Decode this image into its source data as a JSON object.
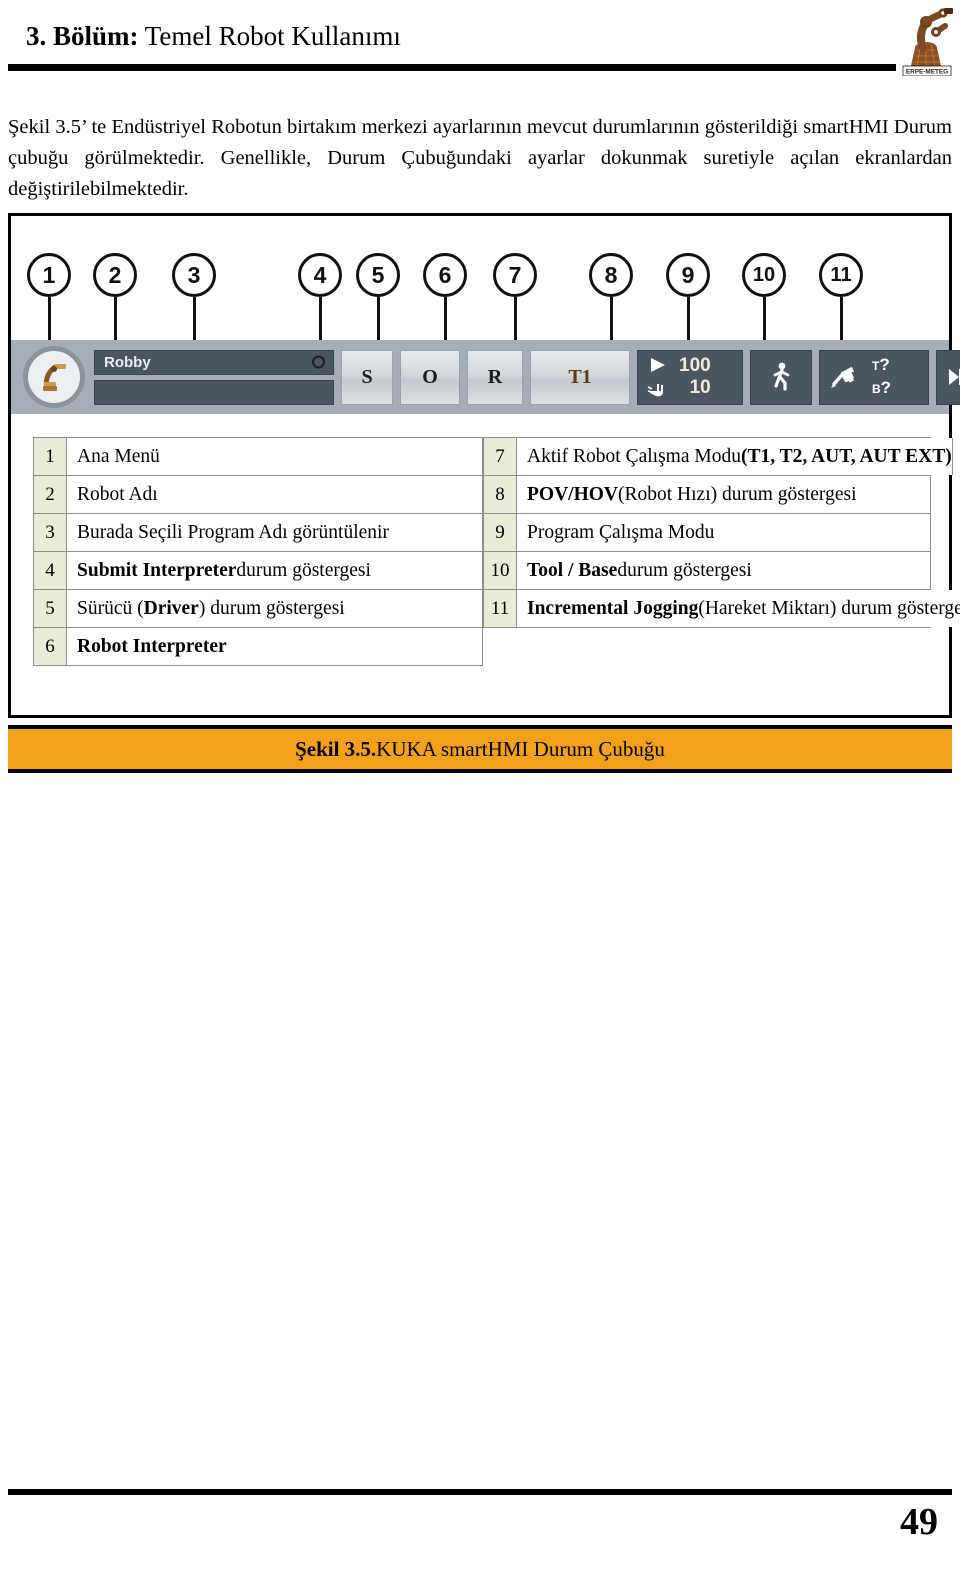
{
  "header": {
    "title_bold": "3. Bölüm:",
    "title_rest": " Temel Robot Kullanımı",
    "logo_text": "ERPE-METEG",
    "logo_icon": "robot-arm-icon"
  },
  "paragraph": {
    "text": "Şekil 3.5’ te Endüstriyel Robotun birtakım merkezi ayarlarının mevcut durumlarının gösterildiği smartHMI Durum çubuğu görülmektedir. Genellikle, Durum Çubuğundaki ayarlar dokunmak suretiyle açılan ekranlardan değiştirilebilmektedir."
  },
  "figure": {
    "callouts": [
      "1",
      "2",
      "3",
      "4",
      "5",
      "6",
      "7",
      "8",
      "9",
      "10",
      "11"
    ],
    "statusbar": {
      "home_icon": "robot-home-icon",
      "robot_name": "Robby",
      "program_name": "",
      "status_dot_icon": "circle-indicator-icon",
      "submit_interpreter_label": "S",
      "driver_label": "O",
      "robot_interpreter_label": "R",
      "operating_mode_label": "T1",
      "pov_play_icon": "play-triangle-icon",
      "pov_value": "100",
      "hov_hand_icon": "hand-jog-icon",
      "hov_value": "10",
      "program_run_mode_icon": "walking-person-icon",
      "tool_base_icon": "tool-flange-icon",
      "tool_label": "T",
      "tool_value": "?",
      "base_label": "B",
      "base_value": "?",
      "increment_icon": "incremental-jog-icon",
      "increment_value": "∞"
    }
  },
  "legend": {
    "left": [
      {
        "num": "1",
        "plain": "Ana Menü",
        "bold": "",
        "tail": ""
      },
      {
        "num": "2",
        "plain": "Robot Adı",
        "bold": "",
        "tail": ""
      },
      {
        "num": "3",
        "plain": "Burada Seçili Program Adı görüntülenir",
        "bold": "",
        "tail": ""
      },
      {
        "num": "4",
        "plain": "",
        "bold": "Submit Interpreter",
        "tail": " durum göstergesi"
      },
      {
        "num": "5",
        "plain": "Sürücü (",
        "bold": "Driver",
        "tail": ") durum göstergesi"
      },
      {
        "num": "6",
        "plain": "",
        "bold": "Robot Interpreter",
        "tail": ""
      }
    ],
    "right": [
      {
        "num": "7",
        "plain": "Aktif Robot Çalışma Modu ",
        "bold": "(T1, T2, AUT, AUT EXT)",
        "tail": ""
      },
      {
        "num": "8",
        "plain": "",
        "bold": "POV/HOV",
        "tail": " (Robot Hızı) durum göstergesi"
      },
      {
        "num": "9",
        "plain": "Program Çalışma Modu",
        "bold": "",
        "tail": ""
      },
      {
        "num": "10",
        "plain": "",
        "bold": "Tool / Base",
        "tail": " durum göstergesi"
      },
      {
        "num": "11",
        "plain": "",
        "bold": "Incremental Jogging",
        "tail": " (Hareket Miktarı) durum göstergesi"
      }
    ]
  },
  "caption": {
    "bold": "Şekil 3.5.",
    "rest": " KUKA smartHMI Durum Çubuğu"
  },
  "footer": {
    "page_number": "49"
  },
  "colors": {
    "caption_orange": "#f3a01b",
    "legend_num_bg": "#e8ecd9",
    "statusbar_bg": "#a5aeb6",
    "statusbar_field": "#4b5661",
    "logo_brown": "#7a4a22",
    "logo_orange": "#c8763a"
  }
}
